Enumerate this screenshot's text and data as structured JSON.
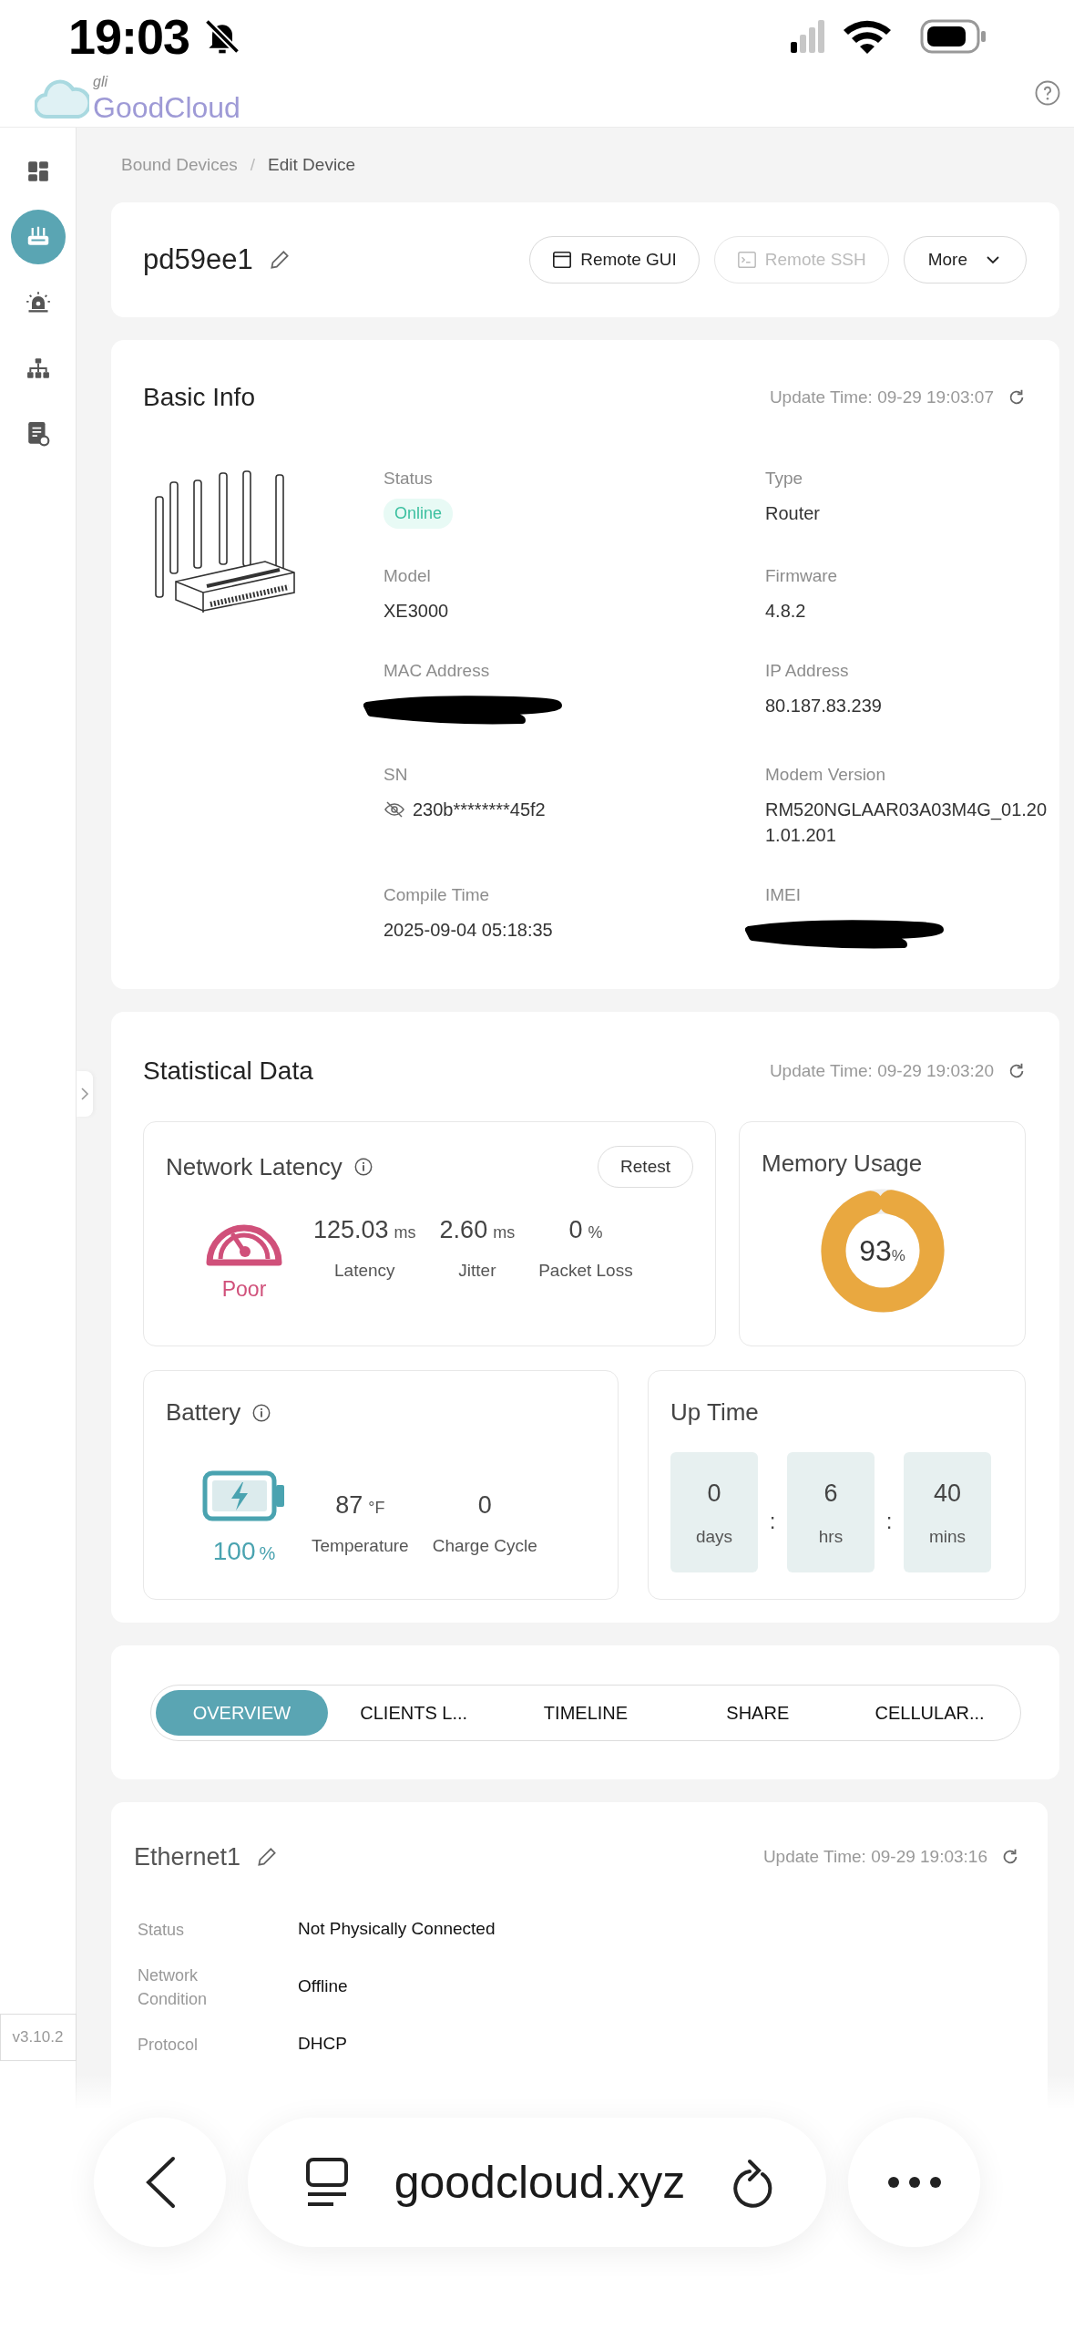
{
  "status_bar": {
    "time": "19:03"
  },
  "app_header": {
    "logo_small": "gli",
    "logo": "GoodCloud"
  },
  "sidebar": {
    "items": [
      {
        "kind": "dashboard",
        "selected": false
      },
      {
        "kind": "router",
        "selected": true
      },
      {
        "kind": "alarm",
        "selected": false
      },
      {
        "kind": "topology",
        "selected": false
      },
      {
        "kind": "log",
        "selected": false
      }
    ],
    "version": "v3.10.2"
  },
  "breadcrumb": {
    "separator": "/",
    "items": [
      {
        "label": "Bound Devices",
        "current": false
      },
      {
        "label": "Edit Device",
        "current": true
      }
    ]
  },
  "device": {
    "name": "pd59ee1",
    "buttons": [
      {
        "label": "Remote GUI",
        "kind": "gui",
        "disabled": false
      },
      {
        "label": "Remote SSH",
        "kind": "ssh",
        "disabled": true
      },
      {
        "label": "More",
        "kind": "menu",
        "disabled": false
      }
    ]
  },
  "basic_info": {
    "title": "Basic Info",
    "update_time": "Update Time: 09-29 19:03:07",
    "fields": [
      {
        "label": "Status",
        "value": "Online",
        "kind": "badge"
      },
      {
        "label": "Type",
        "value": "Router",
        "kind": "text"
      },
      {
        "label": "Model",
        "value": "XE3000",
        "kind": "text"
      },
      {
        "label": "Firmware",
        "value": "4.8.2",
        "kind": "text"
      },
      {
        "label": "MAC Address",
        "kind": "redacted"
      },
      {
        "label": "IP Address",
        "value": "80.187.83.239",
        "kind": "text"
      },
      {
        "label": "SN",
        "value": "230b********45f2",
        "kind": "hidden"
      },
      {
        "label": "Modem Version",
        "value": "RM520NGLAAR03A03M4G_01.201.01.201",
        "kind": "text"
      },
      {
        "label": "Compile Time",
        "value": "2025-09-04 05:18:35",
        "kind": "text"
      },
      {
        "label": "IMEI",
        "kind": "redacted"
      }
    ]
  },
  "statistics": {
    "title": "Statistical Data",
    "update_time": "Update Time: 09-29 19:03:20",
    "latency": {
      "title": "Network Latency",
      "retest": "Retest",
      "quality_label": "Poor",
      "metrics": [
        {
          "value": "125.03",
          "unit": "ms",
          "label": "Latency"
        },
        {
          "value": "2.60",
          "unit": "ms",
          "label": "Jitter"
        },
        {
          "value": "0",
          "unit": "%",
          "label": "Packet Loss"
        }
      ]
    },
    "memory": {
      "title": "Memory Usage",
      "level": 0.93,
      "value": "93",
      "unit": "%"
    },
    "battery": {
      "title": "Battery",
      "value": "100",
      "unit": "%",
      "metrics": [
        {
          "value": "87",
          "unit": "°F",
          "label": "Temperature"
        },
        {
          "value": "0",
          "label": "Charge Cycle"
        }
      ]
    },
    "uptime": {
      "title": "Up Time",
      "parts": [
        {
          "value": "0",
          "unit": "days"
        },
        {
          "value": "6",
          "unit": "hrs"
        },
        {
          "value": "40",
          "unit": "mins"
        }
      ],
      "separators": [
        ":",
        ":"
      ]
    }
  },
  "tabs": [
    {
      "label": "OVERVIEW",
      "selected": true
    },
    {
      "label": "CLIENTS L...",
      "selected": false
    },
    {
      "label": "TIMELINE",
      "selected": false
    },
    {
      "label": "SHARE",
      "selected": false
    },
    {
      "label": "CELLULAR...",
      "selected": false
    }
  ],
  "ethernet": {
    "name": "Ethernet1",
    "update_time": "Update Time: 09-29 19:03:16",
    "rows": [
      {
        "label": "Status",
        "value": "Not Physically Connected"
      },
      {
        "label": "Network Condition",
        "value": "Offline"
      },
      {
        "label": "Protocol",
        "value": "DHCP"
      }
    ]
  },
  "browser_bar": {
    "url": "goodcloud.xyz"
  }
}
